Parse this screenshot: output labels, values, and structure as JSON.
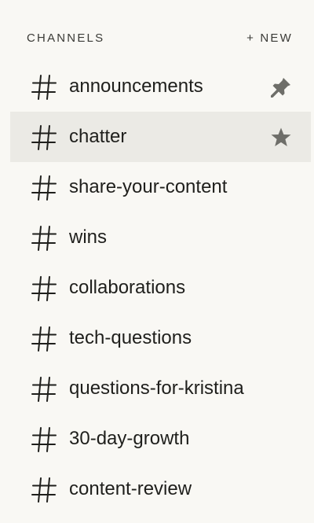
{
  "sidebar": {
    "section_title": "CHANNELS",
    "new_label": "+ NEW",
    "channels": [
      {
        "name": "announcements",
        "icon": "hash-icon",
        "trailing_icon": "pin-icon",
        "active": false
      },
      {
        "name": "chatter",
        "icon": "hash-icon",
        "trailing_icon": "star-icon",
        "active": true
      },
      {
        "name": "share-your-content",
        "icon": "hash-icon",
        "active": false
      },
      {
        "name": "wins",
        "icon": "hash-icon",
        "active": false
      },
      {
        "name": "collaborations",
        "icon": "hash-icon",
        "active": false
      },
      {
        "name": "tech-questions",
        "icon": "hash-icon",
        "active": false
      },
      {
        "name": "questions-for-kristina",
        "icon": "hash-icon",
        "active": false
      },
      {
        "name": "30-day-growth",
        "icon": "hash-icon",
        "active": false
      },
      {
        "name": "content-review",
        "icon": "hash-icon",
        "active": false
      }
    ]
  },
  "colors": {
    "background": "#f9f8f4",
    "active_row": "#ebeae5",
    "text": "#1f1f1c",
    "icon_muted": "#6e6e69"
  }
}
